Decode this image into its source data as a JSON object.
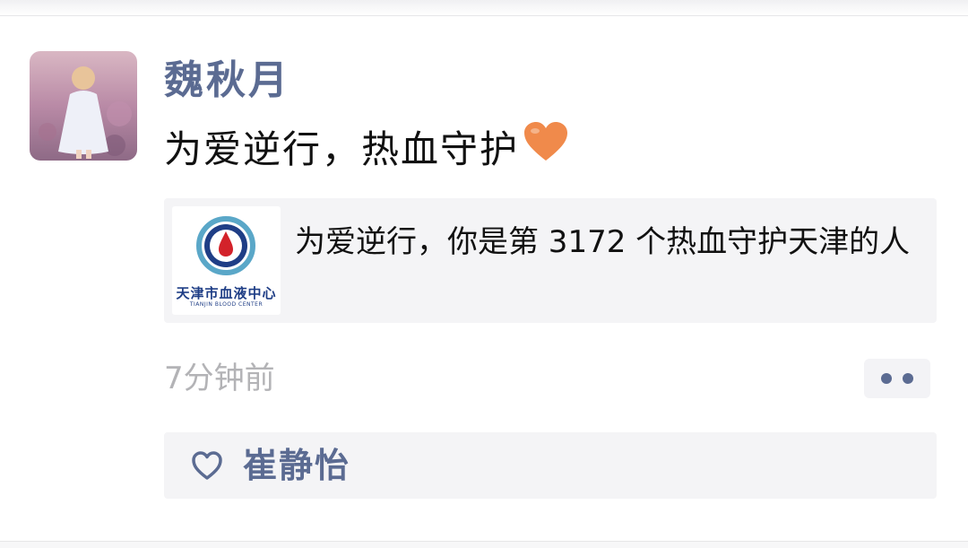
{
  "post": {
    "author": "魏秋月",
    "text": "为爱逆行，热血守护",
    "emoji": "heart-emoji"
  },
  "link_card": {
    "title": "为爱逆行，你是第 3172 个热血守护天津的人",
    "logo_text": "天津市血液中心",
    "logo_subtext": "TIANJIN BLOOD CENTER"
  },
  "meta": {
    "timestamp": "7分钟前"
  },
  "likes": {
    "names": "崔静怡"
  },
  "colors": {
    "name_blue": "#5b6b92",
    "heart_orange": "#f08a4b",
    "logo_blue": "#1f3e86",
    "logo_red": "#d3222a"
  }
}
